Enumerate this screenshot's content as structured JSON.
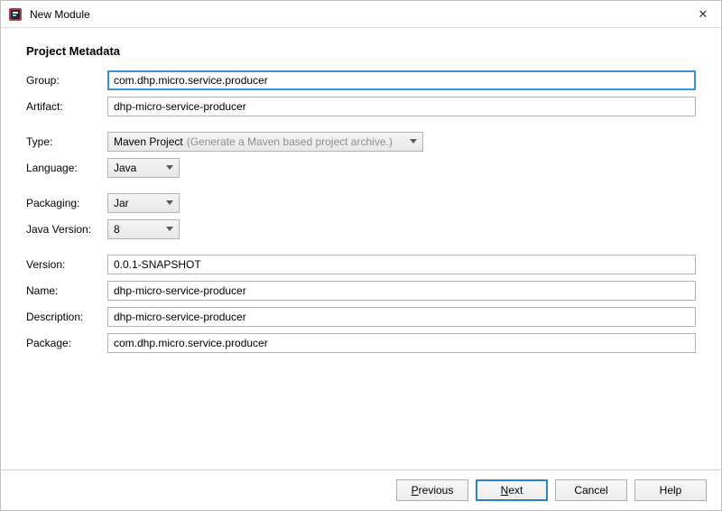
{
  "window": {
    "title": "New Module",
    "close_label": "✕"
  },
  "section_title": "Project Metadata",
  "labels": {
    "group": "Group:",
    "artifact": "Artifact:",
    "type": "Type:",
    "language": "Language:",
    "packaging": "Packaging:",
    "java_version": "Java Version:",
    "version": "Version:",
    "name": "Name:",
    "description": "Description:",
    "package": "Package:"
  },
  "values": {
    "group": "com.dhp.micro.service.producer",
    "artifact": "dhp-micro-service-producer",
    "type": "Maven Project",
    "type_hint": "(Generate a Maven based project archive.)",
    "language": "Java",
    "packaging": "Jar",
    "java_version": "8",
    "version": "0.0.1-SNAPSHOT",
    "name": "dhp-micro-service-producer",
    "description": "dhp-micro-service-producer",
    "package": "com.dhp.micro.service.producer"
  },
  "buttons": {
    "previous_pre": "",
    "previous_u": "P",
    "previous_post": "revious",
    "next_pre": "",
    "next_u": "N",
    "next_post": "ext",
    "cancel": "Cancel",
    "help": "Help"
  }
}
